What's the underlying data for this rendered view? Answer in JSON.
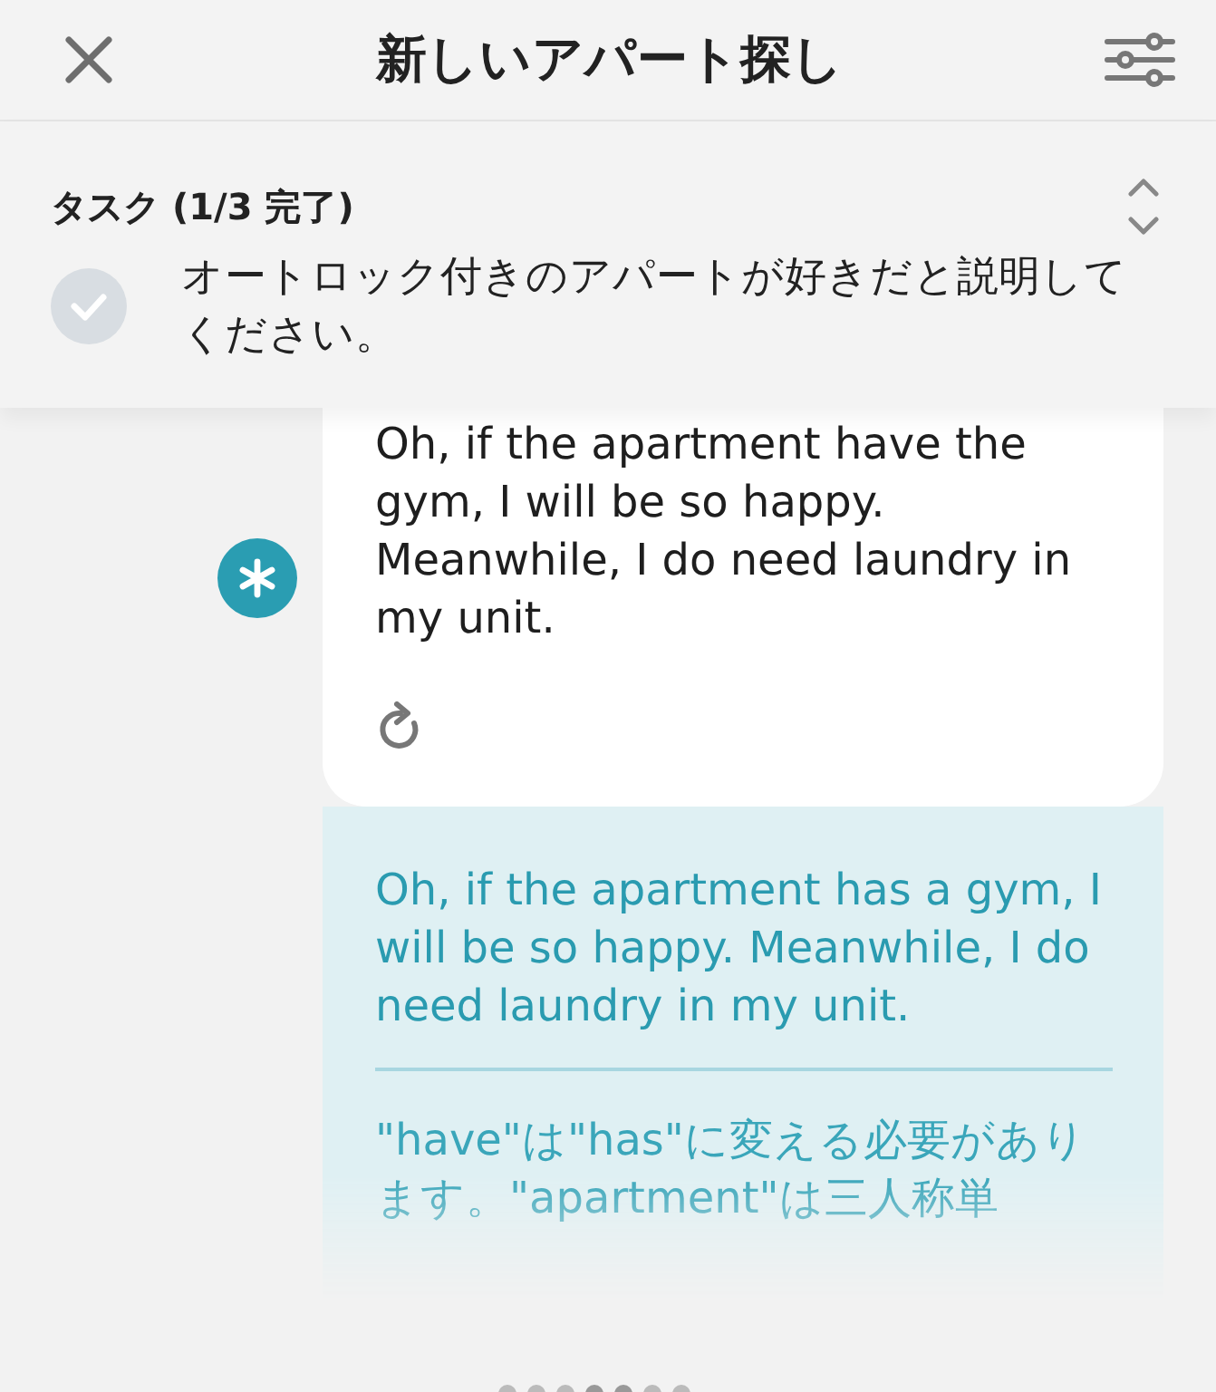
{
  "header": {
    "title": "新しいアパート探し"
  },
  "task_panel": {
    "heading": "タスク (1/3 完了)",
    "expanded": true,
    "tasks": [
      {
        "text": "オートロック付きのアパートが好きだと説明してください。",
        "done": false
      }
    ]
  },
  "message": {
    "text": "Oh, if the apartment have the gym, I will be so happy. Meanwhile, I do need laundry in my unit.",
    "correction": "Oh, if the apartment has a gym, I will be so happy. Meanwhile, I do need laundry in my unit.",
    "explanation": "\"have\"は\"has\"に変える必要があります。\"apartment\"は三人称単"
  }
}
